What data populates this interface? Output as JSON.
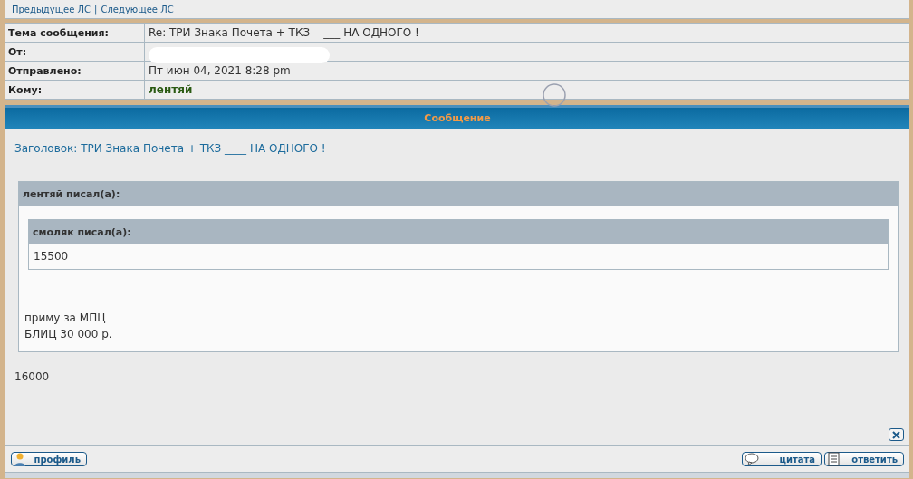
{
  "nav_links": [
    {
      "label": "Предыдущее ЛС"
    },
    {
      "label": "Следующее ЛС"
    }
  ],
  "nav_separator": "|",
  "header_fields": [
    {
      "label": "Тема сообщения:",
      "value": "Re: ТРИ Знака Почета + ТКЗ    ___ НА ОДНОГО !",
      "kind": "text"
    },
    {
      "label": "От:",
      "kind": "redacted"
    },
    {
      "label": "Отправлено:",
      "value": "Пт июн 04, 2021 8:28 pm",
      "kind": "text"
    },
    {
      "label": "Кому:",
      "value": "лентяй",
      "kind": "user"
    }
  ],
  "section_title": "Сообщение",
  "message": {
    "subject": "Заголовок: ТРИ Знака Почета + ТКЗ ____ НА ОДНОГО !",
    "quote": {
      "author": "лентяй писал(а):",
      "inner_quote": {
        "author": "смоляк писал(а):",
        "text": "15500"
      },
      "lines": [
        "приму за МПЦ",
        "БЛИЦ 30 000 р."
      ]
    },
    "text": "16000"
  },
  "buttons_left": [
    {
      "label": "профиль",
      "kind": "profile"
    }
  ],
  "buttons_right": [
    {
      "label": "цитата",
      "kind": "quote"
    },
    {
      "label": "ответить",
      "kind": "reply"
    }
  ]
}
